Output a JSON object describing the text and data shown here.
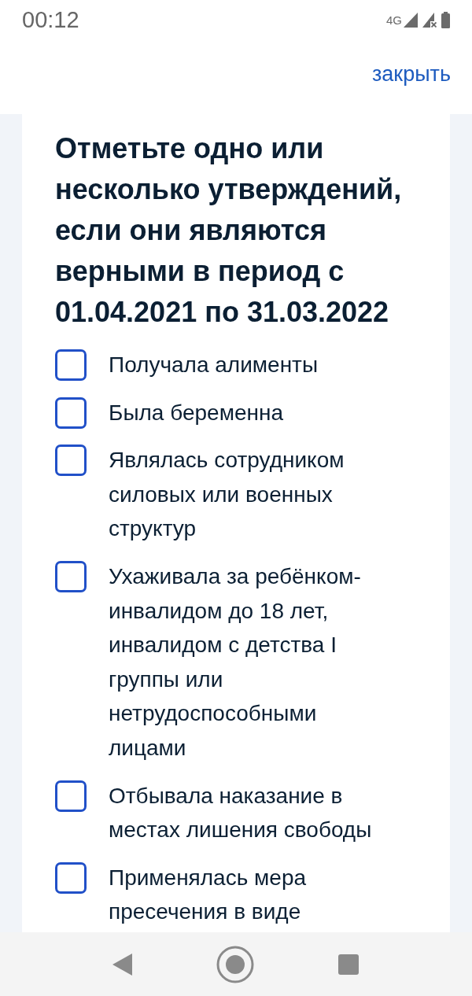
{
  "status_bar": {
    "time": "00:12",
    "network": "4G"
  },
  "header": {
    "close_link": "закрыть"
  },
  "form": {
    "title": "Отметьте одно или несколько утверждений, если они являются верными в период с 01.04.2021 по 31.03.2022",
    "options": [
      {
        "label": "Получала алименты",
        "checked": false
      },
      {
        "label": "Была беременна",
        "checked": false
      },
      {
        "label": "Являлась сотрудником силовых или военных структур",
        "checked": false
      },
      {
        "label": "Ухаживала за ребёнком-инвалидом до 18 лет, инвалидом с детства I группы или нетрудоспособными лицами",
        "checked": false
      },
      {
        "label": "Отбывала наказание в местах лишения свободы",
        "checked": false
      },
      {
        "label": "Применялась мера пресечения в виде",
        "checked": false
      }
    ]
  }
}
